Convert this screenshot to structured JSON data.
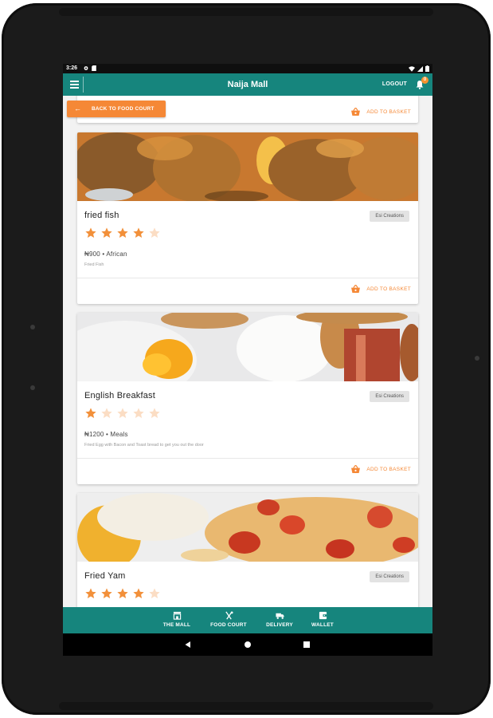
{
  "status_bar": {
    "time": "3:26",
    "icons": [
      "settings-gear-icon",
      "sd-card-icon",
      "wifi-icon",
      "signal-icon",
      "battery-icon"
    ]
  },
  "app_bar": {
    "title": "Naija Mall",
    "logout_label": "LOGOUT",
    "notification_count": "0",
    "menu_icon": "hamburger-menu-icon",
    "bell_icon": "notification-bell-icon"
  },
  "back_button": {
    "label": "BACK TO FOOD COURT",
    "icon": "arrow-left-icon"
  },
  "add_to_basket_label": "ADD TO BASKET",
  "colors": {
    "teal": "#16857d",
    "orange": "#f58836",
    "star": "#f2903a"
  },
  "products": [
    {
      "name": "fried fish",
      "vendor": "Esi Creations",
      "rating": 4,
      "max_rating": 5,
      "price_line": "₦900 • African",
      "description": "Fried Fish",
      "image": "fried-fish-photo"
    },
    {
      "name": "English Breakfast",
      "vendor": "Esi Creations",
      "rating": 1,
      "max_rating": 5,
      "price_line": "₦1200 • Meals",
      "description": "Fried Egg with Bacon and Toast bread to get you out the door",
      "image": "english-breakfast-photo"
    },
    {
      "name": "Fried Yam",
      "vendor": "Esi Creations",
      "rating": 4,
      "max_rating": 5,
      "image": "fried-yam-photo"
    }
  ],
  "bottom_nav": [
    {
      "label": "THE MALL",
      "icon": "store-icon"
    },
    {
      "label": "FOOD COURT",
      "icon": "fork-knife-icon"
    },
    {
      "label": "DELIVERY",
      "icon": "truck-icon"
    },
    {
      "label": "WALLET",
      "icon": "wallet-icon"
    }
  ],
  "system_nav": [
    "back-triangle-icon",
    "home-circle-icon",
    "recents-square-icon"
  ]
}
